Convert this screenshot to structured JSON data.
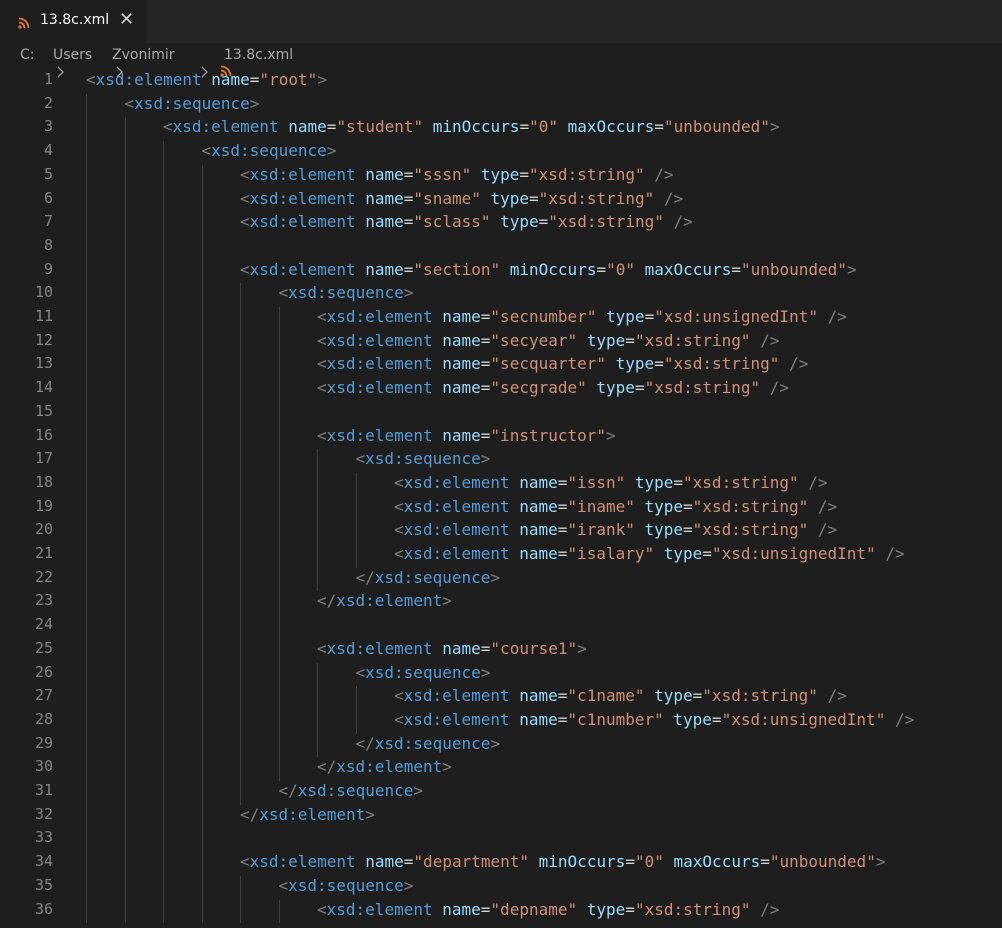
{
  "tab": {
    "filename": "13.8c.xml",
    "close_glyph": "✕",
    "icon": "rss-icon",
    "icon_color": "#e37933"
  },
  "breadcrumb": {
    "parts": [
      "C:",
      "Users",
      "Zvonimir",
      "13.8c.xml"
    ]
  },
  "editor": {
    "lines": [
      {
        "n": "1",
        "indent": 0,
        "code": [
          [
            "<",
            "br"
          ],
          [
            "xsd:element",
            "tag"
          ],
          [
            " name",
            "attr"
          ],
          [
            "=",
            "eq"
          ],
          [
            "\"root\"",
            "str"
          ],
          [
            ">",
            "br"
          ]
        ]
      },
      {
        "n": "2",
        "indent": 1,
        "code": [
          [
            "<",
            "br"
          ],
          [
            "xsd:sequence",
            "tag"
          ],
          [
            ">",
            "br"
          ]
        ]
      },
      {
        "n": "3",
        "indent": 2,
        "code": [
          [
            "<",
            "br"
          ],
          [
            "xsd:element",
            "tag"
          ],
          [
            " name",
            "attr"
          ],
          [
            "=",
            "eq"
          ],
          [
            "\"student\"",
            "str"
          ],
          [
            " minOccurs",
            "attr"
          ],
          [
            "=",
            "eq"
          ],
          [
            "\"0\"",
            "str"
          ],
          [
            " maxOccurs",
            "attr"
          ],
          [
            "=",
            "eq"
          ],
          [
            "\"unbounded\"",
            "str"
          ],
          [
            ">",
            "br"
          ]
        ]
      },
      {
        "n": "4",
        "indent": 3,
        "code": [
          [
            "<",
            "br"
          ],
          [
            "xsd:sequence",
            "tag"
          ],
          [
            ">",
            "br"
          ]
        ]
      },
      {
        "n": "5",
        "indent": 4,
        "code": [
          [
            "<",
            "br"
          ],
          [
            "xsd:element",
            "tag"
          ],
          [
            " name",
            "attr"
          ],
          [
            "=",
            "eq"
          ],
          [
            "\"sssn\"",
            "str"
          ],
          [
            " type",
            "attr"
          ],
          [
            "=",
            "eq"
          ],
          [
            "\"xsd:string\"",
            "str"
          ],
          [
            " />",
            "br"
          ]
        ]
      },
      {
        "n": "6",
        "indent": 4,
        "code": [
          [
            "<",
            "br"
          ],
          [
            "xsd:element",
            "tag"
          ],
          [
            " name",
            "attr"
          ],
          [
            "=",
            "eq"
          ],
          [
            "\"sname\"",
            "str"
          ],
          [
            " type",
            "attr"
          ],
          [
            "=",
            "eq"
          ],
          [
            "\"xsd:string\"",
            "str"
          ],
          [
            " />",
            "br"
          ]
        ]
      },
      {
        "n": "7",
        "indent": 4,
        "code": [
          [
            "<",
            "br"
          ],
          [
            "xsd:element",
            "tag"
          ],
          [
            " name",
            "attr"
          ],
          [
            "=",
            "eq"
          ],
          [
            "\"sclass\"",
            "str"
          ],
          [
            " type",
            "attr"
          ],
          [
            "=",
            "eq"
          ],
          [
            "\"xsd:string\"",
            "str"
          ],
          [
            " />",
            "br"
          ]
        ]
      },
      {
        "n": "8",
        "indent": 0,
        "code": []
      },
      {
        "n": "9",
        "indent": 4,
        "code": [
          [
            "<",
            "br"
          ],
          [
            "xsd:element",
            "tag"
          ],
          [
            " name",
            "attr"
          ],
          [
            "=",
            "eq"
          ],
          [
            "\"section\"",
            "str"
          ],
          [
            " minOccurs",
            "attr"
          ],
          [
            "=",
            "eq"
          ],
          [
            "\"0\"",
            "str"
          ],
          [
            " maxOccurs",
            "attr"
          ],
          [
            "=",
            "eq"
          ],
          [
            "\"unbounded\"",
            "str"
          ],
          [
            ">",
            "br"
          ]
        ]
      },
      {
        "n": "10",
        "indent": 5,
        "code": [
          [
            "<",
            "br"
          ],
          [
            "xsd:sequence",
            "tag"
          ],
          [
            ">",
            "br"
          ]
        ]
      },
      {
        "n": "11",
        "indent": 6,
        "code": [
          [
            "<",
            "br"
          ],
          [
            "xsd:element",
            "tag"
          ],
          [
            " name",
            "attr"
          ],
          [
            "=",
            "eq"
          ],
          [
            "\"secnumber\"",
            "str"
          ],
          [
            " type",
            "attr"
          ],
          [
            "=",
            "eq"
          ],
          [
            "\"xsd:unsignedInt\"",
            "str"
          ],
          [
            " />",
            "br"
          ]
        ]
      },
      {
        "n": "12",
        "indent": 6,
        "code": [
          [
            "<",
            "br"
          ],
          [
            "xsd:element",
            "tag"
          ],
          [
            " name",
            "attr"
          ],
          [
            "=",
            "eq"
          ],
          [
            "\"secyear\"",
            "str"
          ],
          [
            " type",
            "attr"
          ],
          [
            "=",
            "eq"
          ],
          [
            "\"xsd:string\"",
            "str"
          ],
          [
            " />",
            "br"
          ]
        ]
      },
      {
        "n": "13",
        "indent": 6,
        "code": [
          [
            "<",
            "br"
          ],
          [
            "xsd:element",
            "tag"
          ],
          [
            " name",
            "attr"
          ],
          [
            "=",
            "eq"
          ],
          [
            "\"secquarter\"",
            "str"
          ],
          [
            " type",
            "attr"
          ],
          [
            "=",
            "eq"
          ],
          [
            "\"xsd:string\"",
            "str"
          ],
          [
            " />",
            "br"
          ]
        ]
      },
      {
        "n": "14",
        "indent": 6,
        "code": [
          [
            "<",
            "br"
          ],
          [
            "xsd:element",
            "tag"
          ],
          [
            " name",
            "attr"
          ],
          [
            "=",
            "eq"
          ],
          [
            "\"secgrade\"",
            "str"
          ],
          [
            " type",
            "attr"
          ],
          [
            "=",
            "eq"
          ],
          [
            "\"xsd:string\"",
            "str"
          ],
          [
            " />",
            "br"
          ]
        ]
      },
      {
        "n": "15",
        "indent": 0,
        "code": []
      },
      {
        "n": "16",
        "indent": 6,
        "code": [
          [
            "<",
            "br"
          ],
          [
            "xsd:element",
            "tag"
          ],
          [
            " name",
            "attr"
          ],
          [
            "=",
            "eq"
          ],
          [
            "\"instructor\"",
            "str"
          ],
          [
            ">",
            "br"
          ]
        ]
      },
      {
        "n": "17",
        "indent": 7,
        "code": [
          [
            "<",
            "br"
          ],
          [
            "xsd:sequence",
            "tag"
          ],
          [
            ">",
            "br"
          ]
        ]
      },
      {
        "n": "18",
        "indent": 8,
        "code": [
          [
            "<",
            "br"
          ],
          [
            "xsd:element",
            "tag"
          ],
          [
            " name",
            "attr"
          ],
          [
            "=",
            "eq"
          ],
          [
            "\"issn\"",
            "str"
          ],
          [
            " type",
            "attr"
          ],
          [
            "=",
            "eq"
          ],
          [
            "\"xsd:string\"",
            "str"
          ],
          [
            " />",
            "br"
          ]
        ]
      },
      {
        "n": "19",
        "indent": 8,
        "code": [
          [
            "<",
            "br"
          ],
          [
            "xsd:element",
            "tag"
          ],
          [
            " name",
            "attr"
          ],
          [
            "=",
            "eq"
          ],
          [
            "\"iname\"",
            "str"
          ],
          [
            " type",
            "attr"
          ],
          [
            "=",
            "eq"
          ],
          [
            "\"xsd:string\"",
            "str"
          ],
          [
            " />",
            "br"
          ]
        ]
      },
      {
        "n": "20",
        "indent": 8,
        "code": [
          [
            "<",
            "br"
          ],
          [
            "xsd:element",
            "tag"
          ],
          [
            " name",
            "attr"
          ],
          [
            "=",
            "eq"
          ],
          [
            "\"irank\"",
            "str"
          ],
          [
            " type",
            "attr"
          ],
          [
            "=",
            "eq"
          ],
          [
            "\"xsd:string\"",
            "str"
          ],
          [
            " />",
            "br"
          ]
        ]
      },
      {
        "n": "21",
        "indent": 8,
        "code": [
          [
            "<",
            "br"
          ],
          [
            "xsd:element",
            "tag"
          ],
          [
            " name",
            "attr"
          ],
          [
            "=",
            "eq"
          ],
          [
            "\"isalary\"",
            "str"
          ],
          [
            " type",
            "attr"
          ],
          [
            "=",
            "eq"
          ],
          [
            "\"xsd:unsignedInt\"",
            "str"
          ],
          [
            " />",
            "br"
          ]
        ]
      },
      {
        "n": "22",
        "indent": 7,
        "code": [
          [
            "</",
            "br"
          ],
          [
            "xsd:sequence",
            "tag"
          ],
          [
            ">",
            "br"
          ]
        ]
      },
      {
        "n": "23",
        "indent": 6,
        "code": [
          [
            "</",
            "br"
          ],
          [
            "xsd:element",
            "tag"
          ],
          [
            ">",
            "br"
          ]
        ]
      },
      {
        "n": "24",
        "indent": 0,
        "code": []
      },
      {
        "n": "25",
        "indent": 6,
        "code": [
          [
            "<",
            "br"
          ],
          [
            "xsd:element",
            "tag"
          ],
          [
            " name",
            "attr"
          ],
          [
            "=",
            "eq"
          ],
          [
            "\"course1\"",
            "str"
          ],
          [
            ">",
            "br"
          ]
        ]
      },
      {
        "n": "26",
        "indent": 7,
        "code": [
          [
            "<",
            "br"
          ],
          [
            "xsd:sequence",
            "tag"
          ],
          [
            ">",
            "br"
          ]
        ]
      },
      {
        "n": "27",
        "indent": 8,
        "code": [
          [
            "<",
            "br"
          ],
          [
            "xsd:element",
            "tag"
          ],
          [
            " name",
            "attr"
          ],
          [
            "=",
            "eq"
          ],
          [
            "\"c1name\"",
            "str"
          ],
          [
            " type",
            "attr"
          ],
          [
            "=",
            "eq"
          ],
          [
            "\"xsd:string\"",
            "str"
          ],
          [
            " />",
            "br"
          ]
        ]
      },
      {
        "n": "28",
        "indent": 8,
        "code": [
          [
            "<",
            "br"
          ],
          [
            "xsd:element",
            "tag"
          ],
          [
            " name",
            "attr"
          ],
          [
            "=",
            "eq"
          ],
          [
            "\"c1number\"",
            "str"
          ],
          [
            " type",
            "attr"
          ],
          [
            "=",
            "eq"
          ],
          [
            "\"xsd:unsignedInt\"",
            "str"
          ],
          [
            " />",
            "br"
          ]
        ]
      },
      {
        "n": "29",
        "indent": 7,
        "code": [
          [
            "</",
            "br"
          ],
          [
            "xsd:sequence",
            "tag"
          ],
          [
            ">",
            "br"
          ]
        ]
      },
      {
        "n": "30",
        "indent": 6,
        "code": [
          [
            "</",
            "br"
          ],
          [
            "xsd:element",
            "tag"
          ],
          [
            ">",
            "br"
          ]
        ]
      },
      {
        "n": "31",
        "indent": 5,
        "code": [
          [
            "</",
            "br"
          ],
          [
            "xsd:sequence",
            "tag"
          ],
          [
            ">",
            "br"
          ]
        ]
      },
      {
        "n": "32",
        "indent": 4,
        "code": [
          [
            "</",
            "br"
          ],
          [
            "xsd:element",
            "tag"
          ],
          [
            ">",
            "br"
          ]
        ]
      },
      {
        "n": "33",
        "indent": 0,
        "code": []
      },
      {
        "n": "34",
        "indent": 4,
        "code": [
          [
            "<",
            "br"
          ],
          [
            "xsd:element",
            "tag"
          ],
          [
            " name",
            "attr"
          ],
          [
            "=",
            "eq"
          ],
          [
            "\"department\"",
            "str"
          ],
          [
            " minOccurs",
            "attr"
          ],
          [
            "=",
            "eq"
          ],
          [
            "\"0\"",
            "str"
          ],
          [
            " maxOccurs",
            "attr"
          ],
          [
            "=",
            "eq"
          ],
          [
            "\"unbounded\"",
            "str"
          ],
          [
            ">",
            "br"
          ]
        ]
      },
      {
        "n": "35",
        "indent": 5,
        "code": [
          [
            "<",
            "br"
          ],
          [
            "xsd:sequence",
            "tag"
          ],
          [
            ">",
            "br"
          ]
        ]
      },
      {
        "n": "36",
        "indent": 6,
        "code": [
          [
            "<",
            "br"
          ],
          [
            "xsd:element",
            "tag"
          ],
          [
            " name",
            "attr"
          ],
          [
            "=",
            "eq"
          ],
          [
            "\"depname\"",
            "str"
          ],
          [
            " type",
            "attr"
          ],
          [
            "=",
            "eq"
          ],
          [
            "\"xsd:string\"",
            "str"
          ],
          [
            " />",
            "br"
          ]
        ]
      }
    ]
  }
}
